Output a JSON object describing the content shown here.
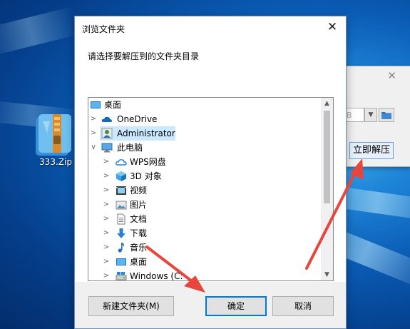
{
  "desktop": {
    "icon_label": "333.Zip"
  },
  "background_window": {
    "path_partial": "B",
    "extract_button": "立即解压"
  },
  "dialog": {
    "title": "浏览文件夹",
    "close_glyph": "✕",
    "instruction": "请选择要解压到的文件夹目录",
    "tree": [
      {
        "label": "桌面",
        "icon": "desktop-icon",
        "level": 0
      },
      {
        "label": "OneDrive",
        "icon": "cloud-icon",
        "level": 1,
        "expandable": true
      },
      {
        "label": "Administrator",
        "icon": "user-icon",
        "level": 1,
        "expandable": true,
        "selected": true
      },
      {
        "label": "此电脑",
        "icon": "computer-icon",
        "level": 1,
        "expanded": true
      },
      {
        "label": "WPS网盘",
        "icon": "wps-cloud-icon",
        "level": 2,
        "expandable": true
      },
      {
        "label": "3D 对象",
        "icon": "3d-objects-icon",
        "level": 2,
        "expandable": true
      },
      {
        "label": "视频",
        "icon": "video-icon",
        "level": 2,
        "expandable": true
      },
      {
        "label": "图片",
        "icon": "pictures-icon",
        "level": 2,
        "expandable": true
      },
      {
        "label": "文档",
        "icon": "documents-icon",
        "level": 2,
        "expandable": true
      },
      {
        "label": "下载",
        "icon": "downloads-icon",
        "level": 2,
        "expandable": true
      },
      {
        "label": "音乐",
        "icon": "music-icon",
        "level": 2,
        "expandable": true
      },
      {
        "label": "桌面",
        "icon": "desktop-icon",
        "level": 2,
        "expandable": true
      },
      {
        "label": "Windows (C:",
        "icon": "drive-icon",
        "level": 2,
        "expandable": true
      }
    ],
    "buttons": {
      "new_folder": "新建文件夹(M)",
      "ok": "确定",
      "cancel": "取消"
    }
  },
  "colors": {
    "selection": "#cce8ff",
    "annotation_arrow": "#e8453c",
    "accent": "#0078d7"
  }
}
